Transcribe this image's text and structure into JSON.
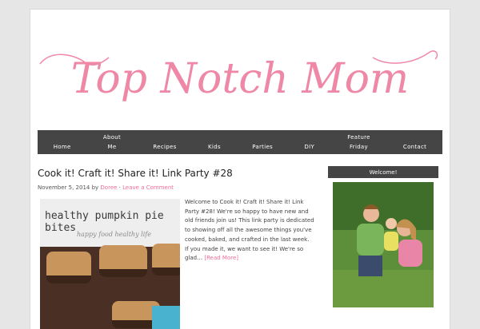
{
  "site": {
    "logo_text": "Top Notch Mom"
  },
  "nav": {
    "items": [
      {
        "label": "Home"
      },
      {
        "label": "About Me"
      },
      {
        "label": "Recipes"
      },
      {
        "label": "Kids"
      },
      {
        "label": "Parties"
      },
      {
        "label": "DIY"
      },
      {
        "label": "Feature Friday"
      },
      {
        "label": "Contact"
      }
    ]
  },
  "post": {
    "title": "Cook it! Craft it! Share it! Link Party #28",
    "date": "November 5, 2014",
    "by": "by",
    "author": "Doree",
    "separator": "·",
    "comment_link": "Leave a Comment",
    "image_title": "healthy pumpkin pie bites",
    "image_subtitle": "happy food healthy life",
    "excerpt": "Welcome to Cook it! Craft it! Share it! Link Party #28! We're so happy to have new and old friends join us! This link party is dedicated to showing off all the awesome things you've cooked, baked, and crafted in the last week. If you made it, we want to see it! We're so glad…",
    "read_more": "[Read More]"
  },
  "sidebar": {
    "widget_title": "Welcome!"
  },
  "colors": {
    "accent_pink": "#ee88a6",
    "nav_bg": "#454545",
    "page_bg": "#e6e6e6"
  }
}
